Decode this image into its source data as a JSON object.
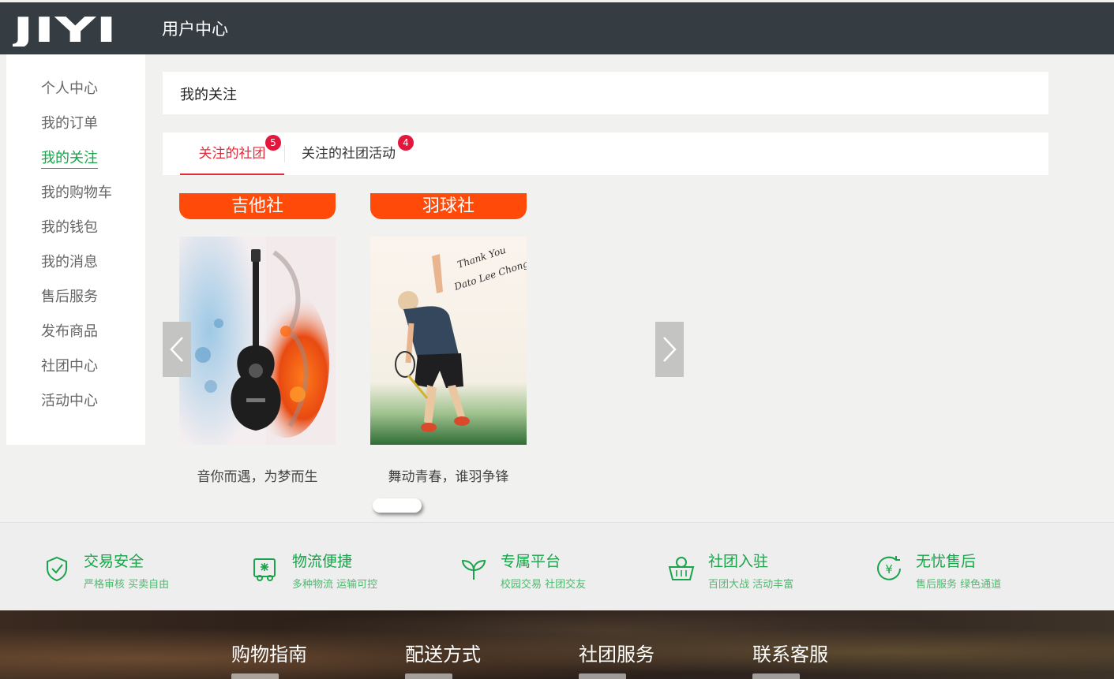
{
  "header": {
    "logo_text": "JIYI",
    "title": "用户中心"
  },
  "sidebar": {
    "items": [
      {
        "label": "个人中心",
        "active": false
      },
      {
        "label": "我的订单",
        "active": false
      },
      {
        "label": "我的关注",
        "active": true
      },
      {
        "label": "我的购物车",
        "active": false
      },
      {
        "label": "我的钱包",
        "active": false
      },
      {
        "label": "我的消息",
        "active": false
      },
      {
        "label": "售后服务",
        "active": false
      },
      {
        "label": "发布商品",
        "active": false
      },
      {
        "label": "社团中心",
        "active": false
      },
      {
        "label": "活动中心",
        "active": false
      }
    ]
  },
  "main": {
    "title": "我的关注",
    "tabs": [
      {
        "label": "关注的社团",
        "badge": "5",
        "active": true
      },
      {
        "label": "关注的社团活动",
        "badge": "4",
        "active": false
      }
    ],
    "clubs": [
      {
        "name": "吉他社",
        "slogan": "音你而遇，为梦而生",
        "image": "guitar-image"
      },
      {
        "name": "羽球社",
        "slogan": "舞动青春，谁羽争锋",
        "image": "badminton-image",
        "image_text": [
          "Thank You",
          "Dato Lee Chong Wei"
        ]
      }
    ]
  },
  "features": [
    {
      "icon": "shield-check-icon",
      "title": "交易安全",
      "subtitle": "严格审核 买卖自由"
    },
    {
      "icon": "delivery-truck-icon",
      "title": "物流便捷",
      "subtitle": "多种物流 运输可控"
    },
    {
      "icon": "sprout-icon",
      "title": "专属平台",
      "subtitle": "校园交易 社团交友"
    },
    {
      "icon": "basket-icon",
      "title": "社团入驻",
      "subtitle": "百团大战 活动丰富"
    },
    {
      "icon": "yen-cycle-icon",
      "title": "无忧售后",
      "subtitle": "售后服务 绿色通道"
    }
  ],
  "footer": {
    "columns": [
      "购物指南",
      "配送方式",
      "社团服务",
      "联系客服"
    ]
  },
  "colors": {
    "accent_green": "#1aa34a",
    "accent_red": "#e22a3a",
    "banner_orange": "#ff4a0a",
    "header_bg": "#353d42"
  }
}
